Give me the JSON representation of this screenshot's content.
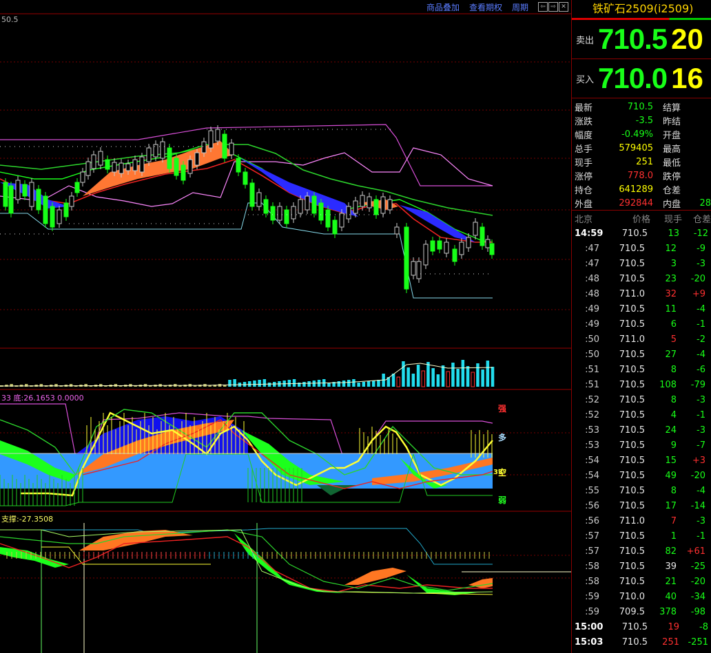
{
  "toolbar": {
    "overlay_label": "商品叠加",
    "rights_label": "查看期权",
    "period_label": "周期"
  },
  "chart": {
    "price_scale_label": "50.5",
    "indicator2_label": "33 底:26.1653 0.0000",
    "indicator3_label": "支撑:-27.3508",
    "markers": {
      "strong": "强",
      "long": "多",
      "short": "空",
      "short_value": "33",
      "weak": "弱"
    }
  },
  "colors": {
    "up": "#ff3030",
    "down": "#18ff18",
    "accent": "#ffd400"
  },
  "quote": {
    "title": "铁矿石2509(i2509)",
    "ask_label": "卖出",
    "ask_price": "710.5",
    "ask_vol": "20",
    "bid_label": "买入",
    "bid_price": "710.0",
    "bid_vol": "16",
    "stats": [
      {
        "k1": "最新",
        "v1": "710.5",
        "c1": "green",
        "k2": "结算",
        "v2": "",
        "c2": "white"
      },
      {
        "k1": "涨跌",
        "v1": "-3.5",
        "c1": "green",
        "k2": "昨结",
        "v2": "",
        "c2": "white"
      },
      {
        "k1": "幅度",
        "v1": "-0.49%",
        "c1": "green",
        "k2": "开盘",
        "v2": "",
        "c2": "white"
      },
      {
        "k1": "总手",
        "v1": "579405",
        "c1": "yellow",
        "k2": "最高",
        "v2": "",
        "c2": "white"
      },
      {
        "k1": "现手",
        "v1": "251",
        "c1": "yellow",
        "k2": "最低",
        "v2": "",
        "c2": "white"
      },
      {
        "k1": "涨停",
        "v1": "778.0",
        "c1": "red",
        "k2": "跌停",
        "v2": "",
        "c2": "white"
      },
      {
        "k1": "持仓",
        "v1": "641289",
        "c1": "yellow",
        "k2": "仓差",
        "v2": "",
        "c2": "white"
      },
      {
        "k1": "外盘",
        "v1": "292844",
        "c1": "red",
        "k2": "内盘",
        "v2": "28",
        "c2": "green"
      }
    ],
    "tick_headers": [
      "北京",
      "价格",
      "现手",
      "仓差"
    ],
    "ticks": [
      {
        "t": "14:59",
        "p": "710.5",
        "v": "13",
        "oi": "-12",
        "vc": "green",
        "oc": "green",
        "bold": true
      },
      {
        "t": ":47",
        "p": "710.5",
        "v": "12",
        "oi": "-9",
        "vc": "green",
        "oc": "green"
      },
      {
        "t": ":47",
        "p": "710.5",
        "v": "3",
        "oi": "-3",
        "vc": "green",
        "oc": "green"
      },
      {
        "t": ":48",
        "p": "710.5",
        "v": "23",
        "oi": "-20",
        "vc": "green",
        "oc": "green"
      },
      {
        "t": ":48",
        "p": "711.0",
        "v": "32",
        "oi": "+9",
        "vc": "red",
        "oc": "red"
      },
      {
        "t": ":49",
        "p": "710.5",
        "v": "11",
        "oi": "-4",
        "vc": "green",
        "oc": "green"
      },
      {
        "t": ":49",
        "p": "710.5",
        "v": "6",
        "oi": "-1",
        "vc": "green",
        "oc": "green"
      },
      {
        "t": ":50",
        "p": "711.0",
        "v": "5",
        "oi": "-2",
        "vc": "red",
        "oc": "green"
      },
      {
        "t": ":50",
        "p": "710.5",
        "v": "27",
        "oi": "-4",
        "vc": "green",
        "oc": "green"
      },
      {
        "t": ":51",
        "p": "710.5",
        "v": "8",
        "oi": "-6",
        "vc": "green",
        "oc": "green"
      },
      {
        "t": ":51",
        "p": "710.5",
        "v": "108",
        "oi": "-79",
        "vc": "green",
        "oc": "green"
      },
      {
        "t": ":52",
        "p": "710.5",
        "v": "8",
        "oi": "-3",
        "vc": "green",
        "oc": "green"
      },
      {
        "t": ":52",
        "p": "710.5",
        "v": "4",
        "oi": "-1",
        "vc": "green",
        "oc": "green"
      },
      {
        "t": ":53",
        "p": "710.5",
        "v": "24",
        "oi": "-3",
        "vc": "green",
        "oc": "green"
      },
      {
        "t": ":53",
        "p": "710.5",
        "v": "9",
        "oi": "-7",
        "vc": "green",
        "oc": "green"
      },
      {
        "t": ":54",
        "p": "710.5",
        "v": "15",
        "oi": "+3",
        "vc": "green",
        "oc": "red"
      },
      {
        "t": ":54",
        "p": "710.5",
        "v": "49",
        "oi": "-20",
        "vc": "green",
        "oc": "green"
      },
      {
        "t": ":55",
        "p": "710.5",
        "v": "8",
        "oi": "-4",
        "vc": "green",
        "oc": "green"
      },
      {
        "t": ":56",
        "p": "710.5",
        "v": "17",
        "oi": "-14",
        "vc": "green",
        "oc": "green"
      },
      {
        "t": ":56",
        "p": "711.0",
        "v": "7",
        "oi": "-3",
        "vc": "red",
        "oc": "green"
      },
      {
        "t": ":57",
        "p": "710.5",
        "v": "1",
        "oi": "-1",
        "vc": "green",
        "oc": "green"
      },
      {
        "t": ":57",
        "p": "710.5",
        "v": "82",
        "oi": "+61",
        "vc": "green",
        "oc": "red"
      },
      {
        "t": ":58",
        "p": "710.5",
        "v": "39",
        "oi": "-25",
        "vc": "white",
        "oc": "green"
      },
      {
        "t": ":58",
        "p": "710.5",
        "v": "21",
        "oi": "-20",
        "vc": "green",
        "oc": "green"
      },
      {
        "t": ":59",
        "p": "710.0",
        "v": "40",
        "oi": "-34",
        "vc": "green",
        "oc": "green"
      },
      {
        "t": ":59",
        "p": "709.5",
        "v": "378",
        "oi": "-98",
        "vc": "green",
        "oc": "green"
      },
      {
        "t": "15:00",
        "p": "710.5",
        "v": "19",
        "oi": "-8",
        "vc": "red",
        "oc": "green",
        "bold": true
      },
      {
        "t": "15:03",
        "p": "710.5",
        "v": "251",
        "oi": "-251",
        "vc": "red",
        "oc": "green",
        "bold": true
      }
    ]
  }
}
